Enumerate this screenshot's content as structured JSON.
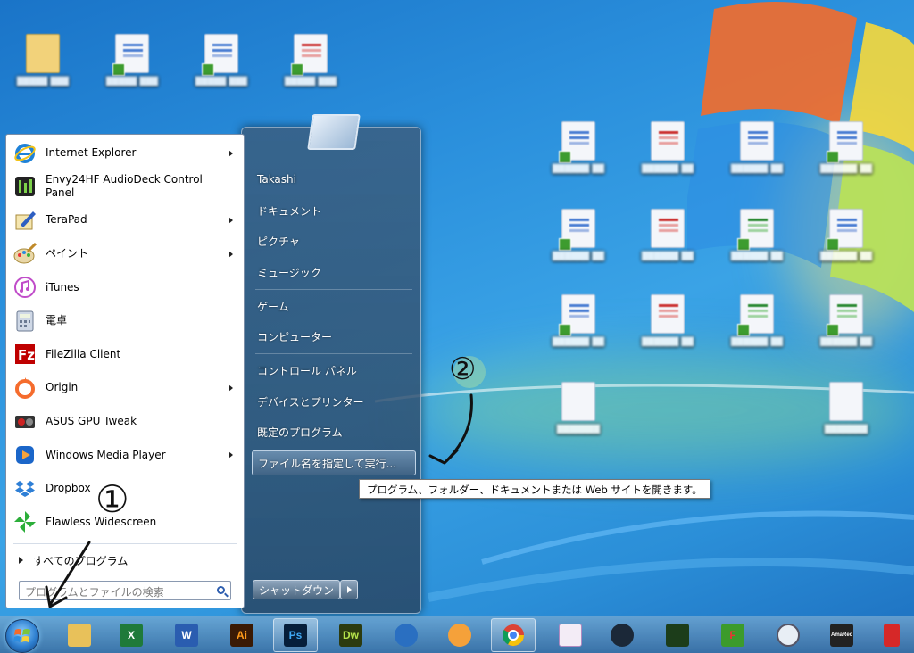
{
  "colors": {
    "wallpaper": "#2a8fdc",
    "start_menu_left_bg": "#ffffff",
    "taskbar": "#4d86b8",
    "annotation_ink": "#111111"
  },
  "start_menu": {
    "programs": [
      {
        "label": "Internet Explorer",
        "icon": "internet-explorer-icon",
        "has_submenu": true
      },
      {
        "label": "Envy24HF AudioDeck Control Panel",
        "icon": "audiodeck-icon",
        "has_submenu": false
      },
      {
        "label": "TeraPad",
        "icon": "terapad-icon",
        "has_submenu": true
      },
      {
        "label": "ペイント",
        "icon": "paint-icon",
        "has_submenu": true
      },
      {
        "label": "iTunes",
        "icon": "itunes-icon",
        "has_submenu": false
      },
      {
        "label": "電卓",
        "icon": "calculator-icon",
        "has_submenu": false
      },
      {
        "label": "FileZilla Client",
        "icon": "filezilla-icon",
        "has_submenu": false
      },
      {
        "label": "Origin",
        "icon": "origin-icon",
        "has_submenu": true
      },
      {
        "label": "ASUS GPU Tweak",
        "icon": "asus-gpu-tweak-icon",
        "has_submenu": false
      },
      {
        "label": "Windows Media Player",
        "icon": "windows-media-player-icon",
        "has_submenu": true
      },
      {
        "label": "Dropbox",
        "icon": "dropbox-icon",
        "has_submenu": false
      },
      {
        "label": "Flawless Widescreen",
        "icon": "flawless-widescreen-icon",
        "has_submenu": false
      }
    ],
    "all_programs": "すべてのプログラム",
    "search_placeholder": "プログラムとファイルの検索",
    "right_items": [
      {
        "label": "Takashi"
      },
      {
        "label": "ドキュメント"
      },
      {
        "label": "ピクチャ"
      },
      {
        "label": "ミュージック"
      },
      {
        "label": "ゲーム"
      },
      {
        "label": "コンピューター"
      },
      {
        "label": "コントロール パネル"
      },
      {
        "label": "デバイスとプリンター"
      },
      {
        "label": "既定のプログラム"
      },
      {
        "label": "ファイル名を指定して実行..."
      }
    ],
    "shutdown_label": "シャットダウン",
    "tooltip": "プログラム、フォルダー、ドキュメントまたは Web サイトを開きます。"
  },
  "annotations": {
    "mark_1": "①",
    "mark_2": "②"
  },
  "taskbar": {
    "apps": [
      {
        "name": "explorer-icon",
        "text": ""
      },
      {
        "name": "excel-icon",
        "text": "X"
      },
      {
        "name": "word-icon",
        "text": "W"
      },
      {
        "name": "illustrator-icon",
        "text": "Ai"
      },
      {
        "name": "photoshop-icon",
        "text": "Ps"
      },
      {
        "name": "dreamweaver-icon",
        "text": "Dw"
      },
      {
        "name": "thunderbird-icon",
        "text": ""
      },
      {
        "name": "scratch-icon",
        "text": ""
      },
      {
        "name": "chrome-icon",
        "text": ""
      },
      {
        "name": "notepad-icon",
        "text": ""
      },
      {
        "name": "steam-icon",
        "text": ""
      },
      {
        "name": "media-icon",
        "text": ""
      },
      {
        "name": "ffmpeg-icon",
        "text": "F"
      },
      {
        "name": "webcam-icon",
        "text": ""
      },
      {
        "name": "amarec-icon",
        "text": "AmaRec"
      },
      {
        "name": "cola-icon",
        "text": ""
      }
    ]
  }
}
